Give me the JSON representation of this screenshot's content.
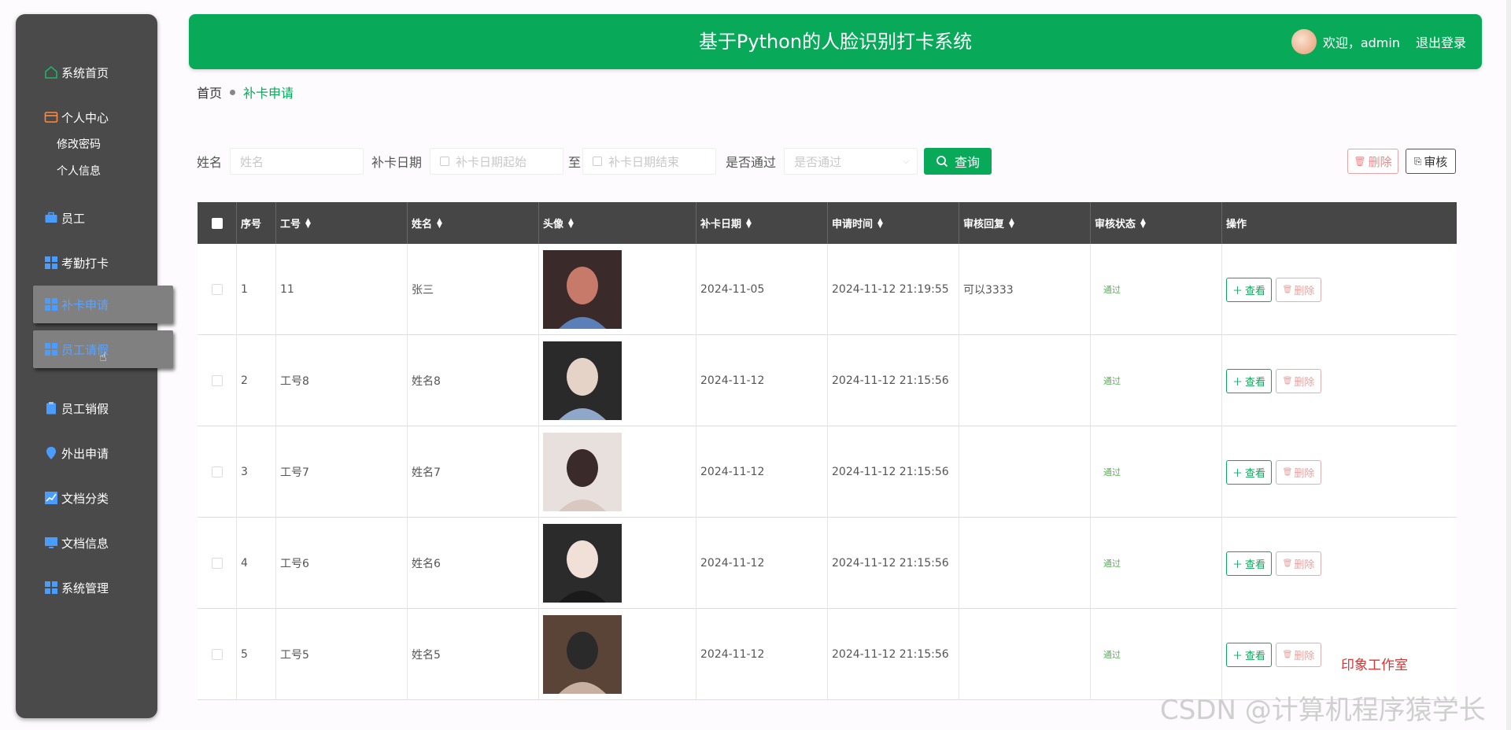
{
  "app": {
    "title": "基于Python的人脸识别打卡系统",
    "welcome": "欢迎，admin",
    "logout": "退出登录",
    "accent": "#09a95a"
  },
  "sidebar": {
    "items": [
      {
        "label": "系统首页",
        "icon": "home-icon"
      },
      {
        "label": "个人中心",
        "icon": "card-icon"
      },
      {
        "label": "员工",
        "icon": "briefcase-icon"
      },
      {
        "label": "考勤打卡",
        "icon": "grid-icon"
      },
      {
        "label": "补卡申请",
        "icon": "grid-icon"
      },
      {
        "label": "员工请假",
        "icon": "grid-icon"
      },
      {
        "label": "员工销假",
        "icon": "clipboard-icon"
      },
      {
        "label": "外出申请",
        "icon": "location-icon"
      },
      {
        "label": "文档分类",
        "icon": "chart-icon"
      },
      {
        "label": "文档信息",
        "icon": "monitor-icon"
      },
      {
        "label": "系统管理",
        "icon": "grid-icon"
      }
    ],
    "sub_items": [
      "修改密码",
      "个人信息"
    ]
  },
  "breadcrumb": {
    "home": "首页",
    "current": "补卡申请"
  },
  "search": {
    "name_label": "姓名",
    "name_placeholder": "姓名",
    "date_label": "补卡日期",
    "date_start_placeholder": "补卡日期起始",
    "to_label": "至",
    "date_end_placeholder": "补卡日期结束",
    "pass_label": "是否通过",
    "pass_placeholder": "是否通过",
    "query_btn": "查询"
  },
  "actions": {
    "delete": "删除",
    "audit": "审核"
  },
  "table": {
    "columns": [
      "序号",
      "工号",
      "姓名",
      "头像",
      "补卡日期",
      "申请时间",
      "审核回复",
      "审核状态",
      "操作"
    ],
    "rows": [
      {
        "index": "1",
        "emp_no": "11",
        "name": "张三",
        "date": "2024-11-05",
        "applied": "2024-11-12 21:19:55",
        "reply": "可以3333",
        "status": "通过"
      },
      {
        "index": "2",
        "emp_no": "工号8",
        "name": "姓名8",
        "date": "2024-11-12",
        "applied": "2024-11-12 21:15:56",
        "reply": "",
        "status": "通过"
      },
      {
        "index": "3",
        "emp_no": "工号7",
        "name": "姓名7",
        "date": "2024-11-12",
        "applied": "2024-11-12 21:15:56",
        "reply": "",
        "status": "通过"
      },
      {
        "index": "4",
        "emp_no": "工号6",
        "name": "姓名6",
        "date": "2024-11-12",
        "applied": "2024-11-12 21:15:56",
        "reply": "",
        "status": "通过"
      },
      {
        "index": "5",
        "emp_no": "工号5",
        "name": "姓名5",
        "date": "2024-11-12",
        "applied": "2024-11-12 21:15:56",
        "reply": "",
        "status": "通过"
      }
    ],
    "view_btn": "查看",
    "delete_btn": "删除"
  },
  "watermarks": {
    "studio": "印象工作室",
    "csdn": "CSDN @计算机程序猿学长"
  }
}
